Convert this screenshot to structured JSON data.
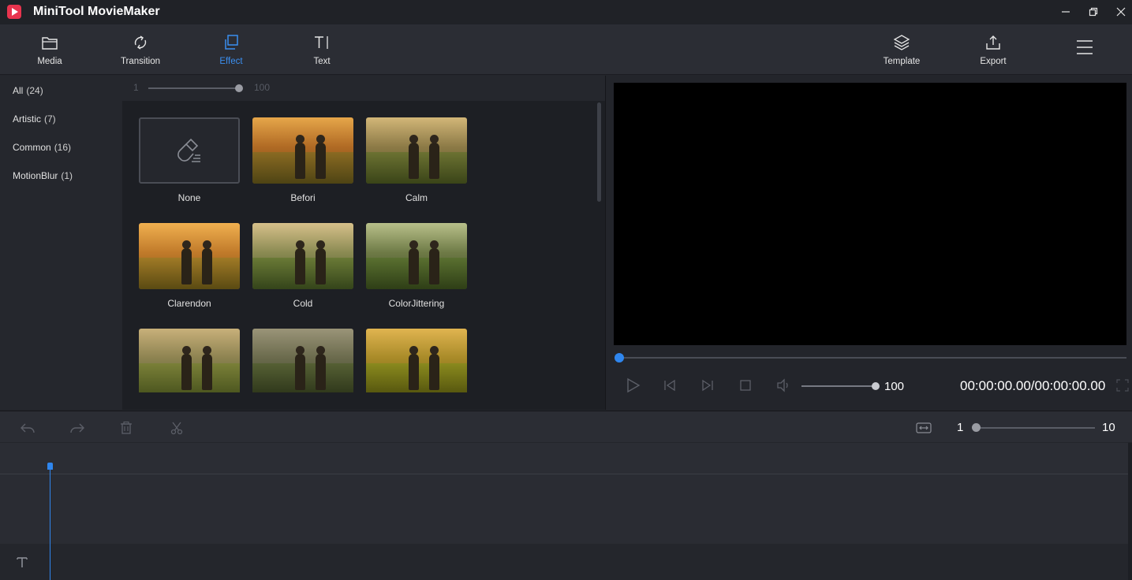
{
  "app": {
    "title": "MiniTool MovieMaker"
  },
  "toolbar": {
    "media": "Media",
    "transition": "Transition",
    "effect": "Effect",
    "text": "Text",
    "template": "Template",
    "export": "Export"
  },
  "categories": [
    {
      "label": "All",
      "count": "(24)"
    },
    {
      "label": "Artistic",
      "count": "(7)"
    },
    {
      "label": "Common",
      "count": "(16)"
    },
    {
      "label": "MotionBlur",
      "count": "(1)"
    }
  ],
  "intensity": {
    "min": "1",
    "max": "100"
  },
  "effects": [
    {
      "label": "None"
    },
    {
      "label": "Befori"
    },
    {
      "label": "Calm"
    },
    {
      "label": "Clarendon"
    },
    {
      "label": "Cold"
    },
    {
      "label": "ColorJittering"
    },
    {
      "label": ""
    },
    {
      "label": ""
    },
    {
      "label": ""
    }
  ],
  "player": {
    "volume": "100",
    "timecode": "00:00:00.00/00:00:00.00"
  },
  "timeline": {
    "zoom_min": "1",
    "zoom_max": "10"
  },
  "colors": {
    "accent": "#2f86ee",
    "active_tab": "#3b8ff0"
  }
}
